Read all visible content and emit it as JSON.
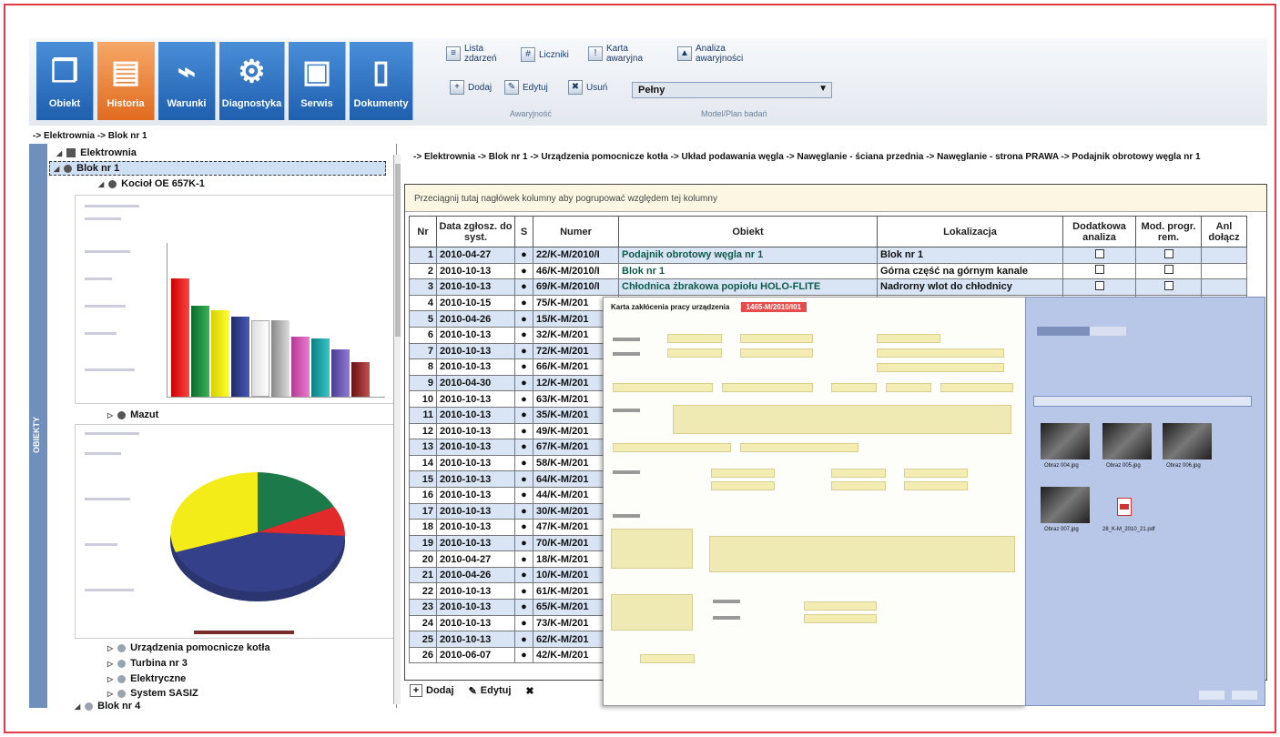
{
  "ribbon": {
    "big_buttons": [
      {
        "label": "Obiekt",
        "icon": "documents-icon",
        "active": false
      },
      {
        "label": "Historia",
        "icon": "book-icon",
        "active": true
      },
      {
        "label": "Warunki",
        "icon": "pulse-icon",
        "active": false
      },
      {
        "label": "Diagnostyka",
        "icon": "gears-icon",
        "active": false
      },
      {
        "label": "Serwis",
        "icon": "service-user-icon",
        "active": false
      },
      {
        "label": "Dokumenty",
        "icon": "document-icon",
        "active": false
      }
    ],
    "lista_zdarzen": "Lista zdarzeń",
    "liczniki": "Liczniki",
    "karta_awaryjna": "Karta awaryjna",
    "analiza_awaryjnosci": "Analiza awaryjności",
    "dodaj": "Dodaj",
    "edytuj": "Edytuj",
    "usun": "Usuń",
    "model_select_value": "Pełny",
    "group_awaryjnosc": "Awaryjność",
    "group_model": "Model/Plan badań"
  },
  "breadcrumb": "-> Elektrownia -> Blok nr 1",
  "tree": {
    "root": "Elektrownia",
    "blok1": "Blok nr 1",
    "kociol": "Kocioł OE 657K-1",
    "mazut": "Mazut",
    "urzadzenia": "Urządzenia pomocnicze kotła",
    "turbina": "Turbina nr 3",
    "elektryczne": "Elektryczne",
    "system": "System SASIZ",
    "blok4": "Blok nr 4",
    "side_tab": "OBIEKTY"
  },
  "main_path": "-> Elektrownia -> Blok nr 1 -> Urządzenia pomocnicze kotła -> Układ podawania węgla -> Nawęglanie - ściana przednia -> Nawęglanie - strona PRAWA -> Podajnik obrotowy węgla nr 1",
  "grid": {
    "group_hint": "Przeciągnij tutaj nagłówek kolumny aby pogrupować względem tej kolumny",
    "columns": [
      "Nr",
      "Data zgłosz. do syst.",
      "S",
      "Numer",
      "Obiekt",
      "Lokalizacja",
      "Dodatkowa analiza",
      "Mod. progr. rem.",
      "Anl dołącz"
    ],
    "rows": [
      {
        "nr": "1",
        "date": "2010-04-27",
        "numer": "22/K-M/2010/I",
        "obiekt": "Podajnik obrotowy węgla nr 1",
        "lok": "Blok nr 1"
      },
      {
        "nr": "2",
        "date": "2010-10-13",
        "numer": "46/K-M/2010/I",
        "obiekt": "Blok nr 1",
        "lok": "Górna część na górnym kanale"
      },
      {
        "nr": "3",
        "date": "2010-10-13",
        "numer": "69/K-M/2010/I",
        "obiekt": "Chłodnica żbrakowa popiołu HOLO-FLITE",
        "lok": "Nadrorny wlot do chłodnicy"
      },
      {
        "nr": "4",
        "date": "2010-10-15",
        "numer": "75/K-M/201",
        "obiekt": "",
        "lok": ""
      },
      {
        "nr": "5",
        "date": "2010-04-26",
        "numer": "15/K-M/201",
        "obiekt": "",
        "lok": ""
      },
      {
        "nr": "6",
        "date": "2010-10-13",
        "numer": "32/K-M/201",
        "obiekt": "",
        "lok": ""
      },
      {
        "nr": "7",
        "date": "2010-10-13",
        "numer": "72/K-M/201",
        "obiekt": "",
        "lok": ""
      },
      {
        "nr": "8",
        "date": "2010-10-13",
        "numer": "66/K-M/201",
        "obiekt": "",
        "lok": ""
      },
      {
        "nr": "9",
        "date": "2010-04-30",
        "numer": "12/K-M/201",
        "obiekt": "",
        "lok": ""
      },
      {
        "nr": "10",
        "date": "2010-10-13",
        "numer": "63/K-M/201",
        "obiekt": "",
        "lok": ""
      },
      {
        "nr": "11",
        "date": "2010-10-13",
        "numer": "35/K-M/201",
        "obiekt": "",
        "lok": ""
      },
      {
        "nr": "12",
        "date": "2010-10-13",
        "numer": "49/K-M/201",
        "obiekt": "",
        "lok": ""
      },
      {
        "nr": "13",
        "date": "2010-10-13",
        "numer": "67/K-M/201",
        "obiekt": "",
        "lok": ""
      },
      {
        "nr": "14",
        "date": "2010-10-13",
        "numer": "58/K-M/201",
        "obiekt": "",
        "lok": ""
      },
      {
        "nr": "15",
        "date": "2010-10-13",
        "numer": "64/K-M/201",
        "obiekt": "",
        "lok": ""
      },
      {
        "nr": "16",
        "date": "2010-10-13",
        "numer": "44/K-M/201",
        "obiekt": "",
        "lok": ""
      },
      {
        "nr": "17",
        "date": "2010-10-13",
        "numer": "30/K-M/201",
        "obiekt": "",
        "lok": ""
      },
      {
        "nr": "18",
        "date": "2010-10-13",
        "numer": "47/K-M/201",
        "obiekt": "",
        "lok": ""
      },
      {
        "nr": "19",
        "date": "2010-10-13",
        "numer": "70/K-M/201",
        "obiekt": "",
        "lok": ""
      },
      {
        "nr": "20",
        "date": "2010-04-27",
        "numer": "18/K-M/201",
        "obiekt": "",
        "lok": ""
      },
      {
        "nr": "21",
        "date": "2010-04-26",
        "numer": "10/K-M/201",
        "obiekt": "",
        "lok": ""
      },
      {
        "nr": "22",
        "date": "2010-10-13",
        "numer": "61/K-M/201",
        "obiekt": "",
        "lok": ""
      },
      {
        "nr": "23",
        "date": "2010-10-13",
        "numer": "65/K-M/201",
        "obiekt": "",
        "lok": ""
      },
      {
        "nr": "24",
        "date": "2010-10-13",
        "numer": "73/K-M/201",
        "obiekt": "",
        "lok": ""
      },
      {
        "nr": "25",
        "date": "2010-10-13",
        "numer": "62/K-M/201",
        "obiekt": "",
        "lok": ""
      },
      {
        "nr": "26",
        "date": "2010-06-07",
        "numer": "42/K-M/201",
        "obiekt": "",
        "lok": ""
      }
    ]
  },
  "bottom": {
    "dodaj": "Dodaj",
    "edytuj": "Edytuj"
  },
  "form": {
    "title": "Karta zakłócenia pracy urządzenia",
    "number": "1465-M/2010/I01"
  },
  "photos": {
    "files": [
      "Obraz 004.jpg",
      "Obraz 005.jpg",
      "Obraz 006.jpg",
      "Obraz 007.jpg",
      "28_K-M_2010_21.pdf"
    ]
  },
  "colors": {
    "accent": "#1e5fae",
    "active": "#e06b1f",
    "frame": "#e23a4a"
  }
}
